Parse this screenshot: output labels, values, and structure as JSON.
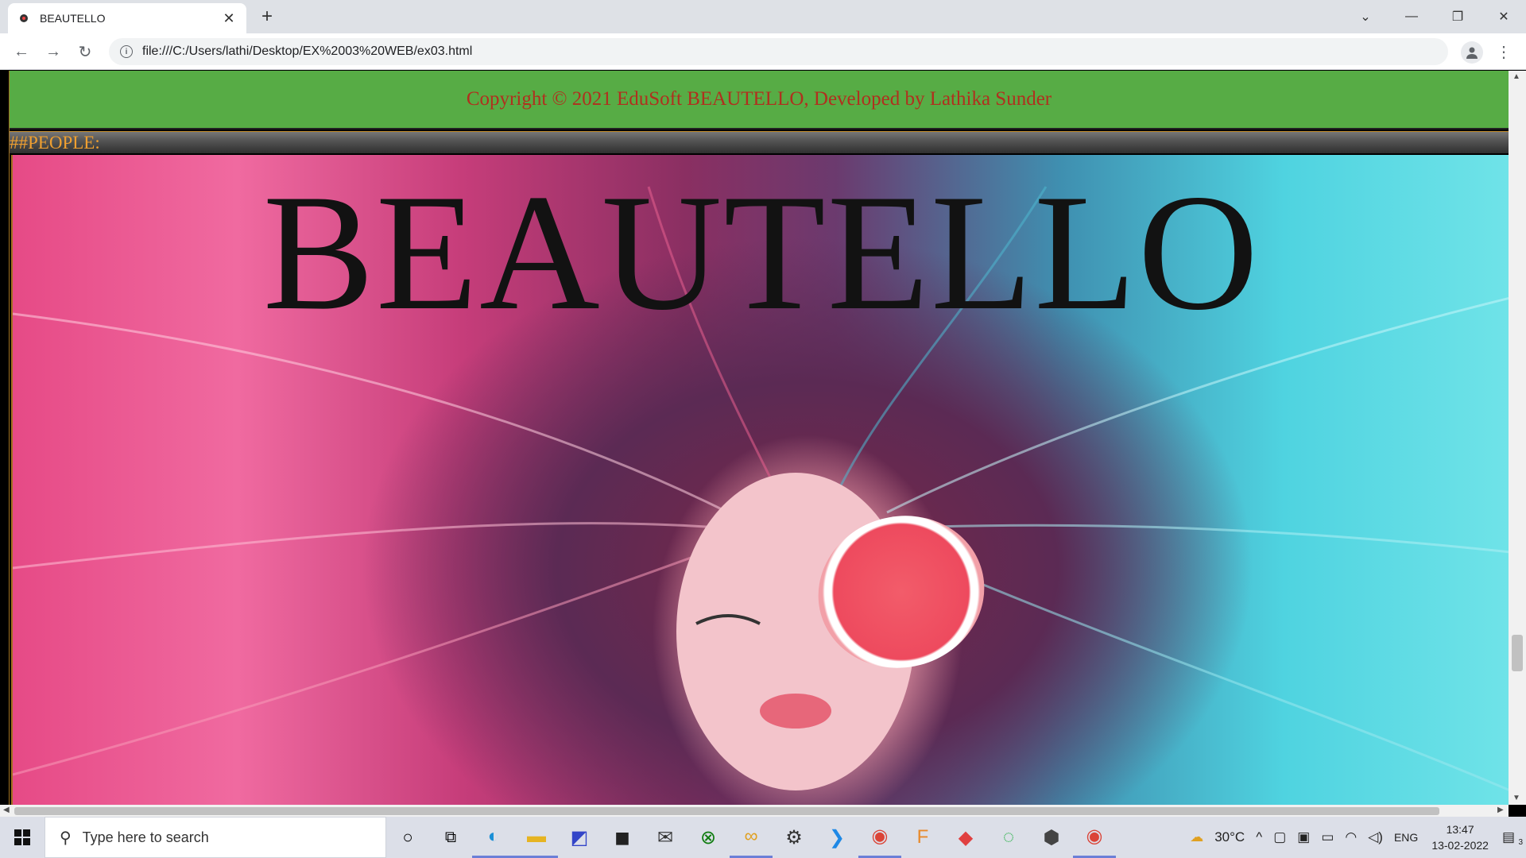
{
  "browser": {
    "tab_title": "BEAUTELLO",
    "url": "file:///C:/Users/lathi/Desktop/EX%2003%20WEB/ex03.html"
  },
  "page": {
    "footer_text": "Copyright © 2021 EduSoft BEAUTELLO, Developed by Lathika Sunder",
    "section_heading": "##PEOPLE:",
    "hero_title": "BEAUTELLO"
  },
  "taskbar": {
    "search_placeholder": "Type here to search",
    "weather": "30°C",
    "language": "ENG",
    "time": "13:47",
    "date": "13-02-2022",
    "notification_count": "3"
  },
  "colors": {
    "footer_bg": "#57ac45",
    "footer_text": "#b0301e",
    "section_heading": "#f0a030"
  }
}
